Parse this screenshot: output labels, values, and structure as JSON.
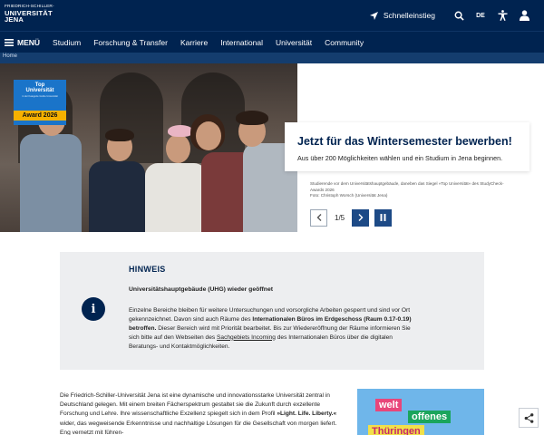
{
  "brand": {
    "line1": "FRIEDRICH-SCHILLER-",
    "line2": "UNIVERSITÄT",
    "line3": "JENA"
  },
  "header": {
    "quick_link": "Schnelleinstieg",
    "language": "DE"
  },
  "nav": {
    "menu_label": "MENÜ",
    "items": [
      "Studium",
      "Forschung & Transfer",
      "Karriere",
      "International",
      "Universität",
      "Community"
    ]
  },
  "breadcrumb": [
    "Home"
  ],
  "hero": {
    "badge": {
      "line1": "Top",
      "line2": "Universität",
      "line3": "in der Kategorie Große Universität",
      "award": "Award 2026"
    },
    "title": "Jetzt für das Wintersemester bewerben!",
    "subtitle": "Aus über 200 Möglichkeiten wählen und ein Studium in Jena beginnen.",
    "caption_line1": "Studierende vor dem Universitätshauptgebäude, daneben das Siegel »Top Universität« des StudyCheck-",
    "caption_line2": "Awards 2026",
    "caption_line3": "Foto: Christoph Worsch (Universität Jena)",
    "slide_counter": "1/5"
  },
  "notice": {
    "title": "HINWEIS",
    "subtitle": "Universitätshauptgebäude (UHG) wieder geöffnet",
    "p1": "Einzelne Bereiche bleiben für weitere Untersuchungen und vorsorgliche Arbeiten gesperrt und sind vor Ort gekennzeichnet. Davon sind auch Räume des",
    "p1_bold": "Internationalen Büros im Erdgeschoss (Raum 0.17-0.19) betroffen.",
    "p2": "Dieser Bereich wird mit Priorität bearbeitet. Bis zur Wiedereröffnung der Räume informieren Sie sich bitte auf den Webseiten des",
    "link": "Sachgebiets Incoming",
    "p3": "des Internationalen Büros über die digitalen Beratungs- und Kontaktmöglichkeiten."
  },
  "intro": {
    "text1": "Die Friedrich-Schiller-Universität Jena ist eine dynamische und innovationsstarke Universität zentral in Deutschland gelegen. Mit einem breiten Fächerspektrum gestaltet sie die Zukunft durch exzellente Forschung und Lehre. Ihre wissenschaftliche Exzellenz spiegelt sich in dem Profil",
    "bold": "»Light. Life. Liberty.«",
    "text2": "wider, das wegweisende Erkenntnisse und nachhaltige Lösungen für die Gesellschaft von morgen liefert. Eng vernetzt mit führen-"
  },
  "promo": {
    "word1": "welt",
    "word2": "offenes",
    "word3": "Thüringen"
  },
  "colors": {
    "navy": "#002350",
    "accent_blue": "#1d4a86",
    "notice_bg": "#edeef0"
  }
}
